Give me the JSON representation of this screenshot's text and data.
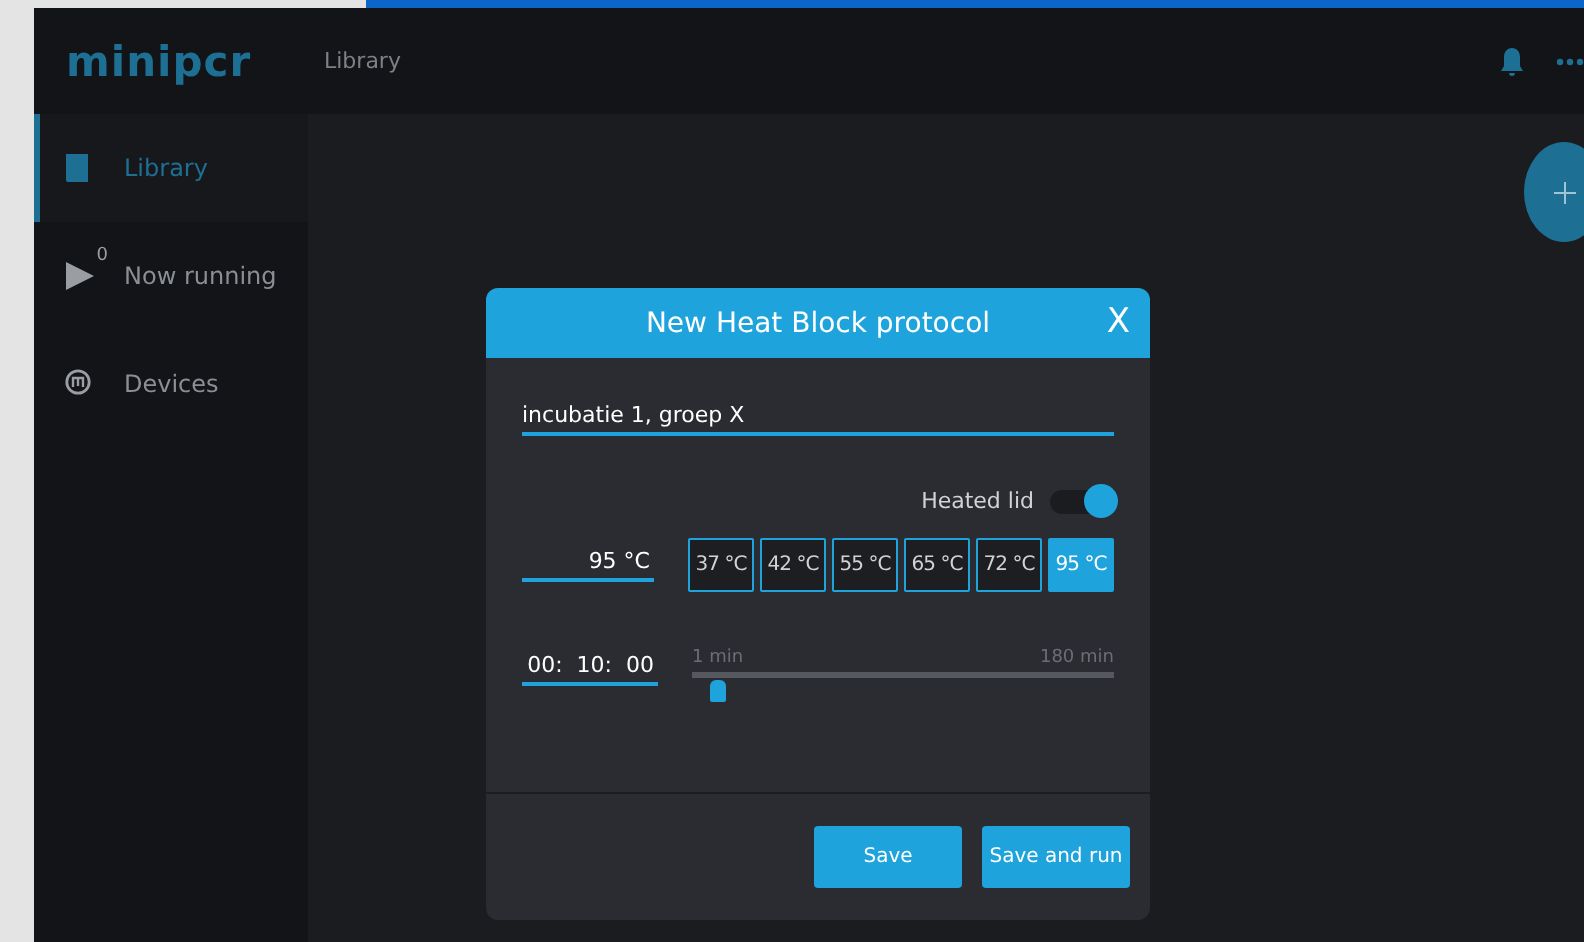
{
  "logo": "minipcr",
  "header": {
    "breadcrumb": "Library"
  },
  "sidebar": {
    "items": [
      {
        "kind": "library",
        "label": "Library",
        "selected": true
      },
      {
        "kind": "running",
        "label": "Now running",
        "badge": "0",
        "selected": false
      },
      {
        "kind": "devices",
        "label": "Devices",
        "selected": false
      }
    ]
  },
  "dialog": {
    "title": "New Heat Block protocol",
    "close": "X",
    "name": {
      "value": "incubatie 1, groep X"
    },
    "heated_lid": {
      "label": "Heated lid",
      "on": true
    },
    "temperature": {
      "value": "95 °C",
      "presets": [
        {
          "label": "37 °C",
          "selected": false
        },
        {
          "label": "42 °C",
          "selected": false
        },
        {
          "label": "55 °C",
          "selected": false
        },
        {
          "label": "65 °C",
          "selected": false
        },
        {
          "label": "72 °C",
          "selected": false
        },
        {
          "label": "95 °C",
          "selected": true
        }
      ]
    },
    "time": {
      "value": "00:  10:  00",
      "min_label": "1 min",
      "max_label": "180 min",
      "level": 0.06
    },
    "buttons": [
      "Save",
      "Save and run"
    ]
  }
}
